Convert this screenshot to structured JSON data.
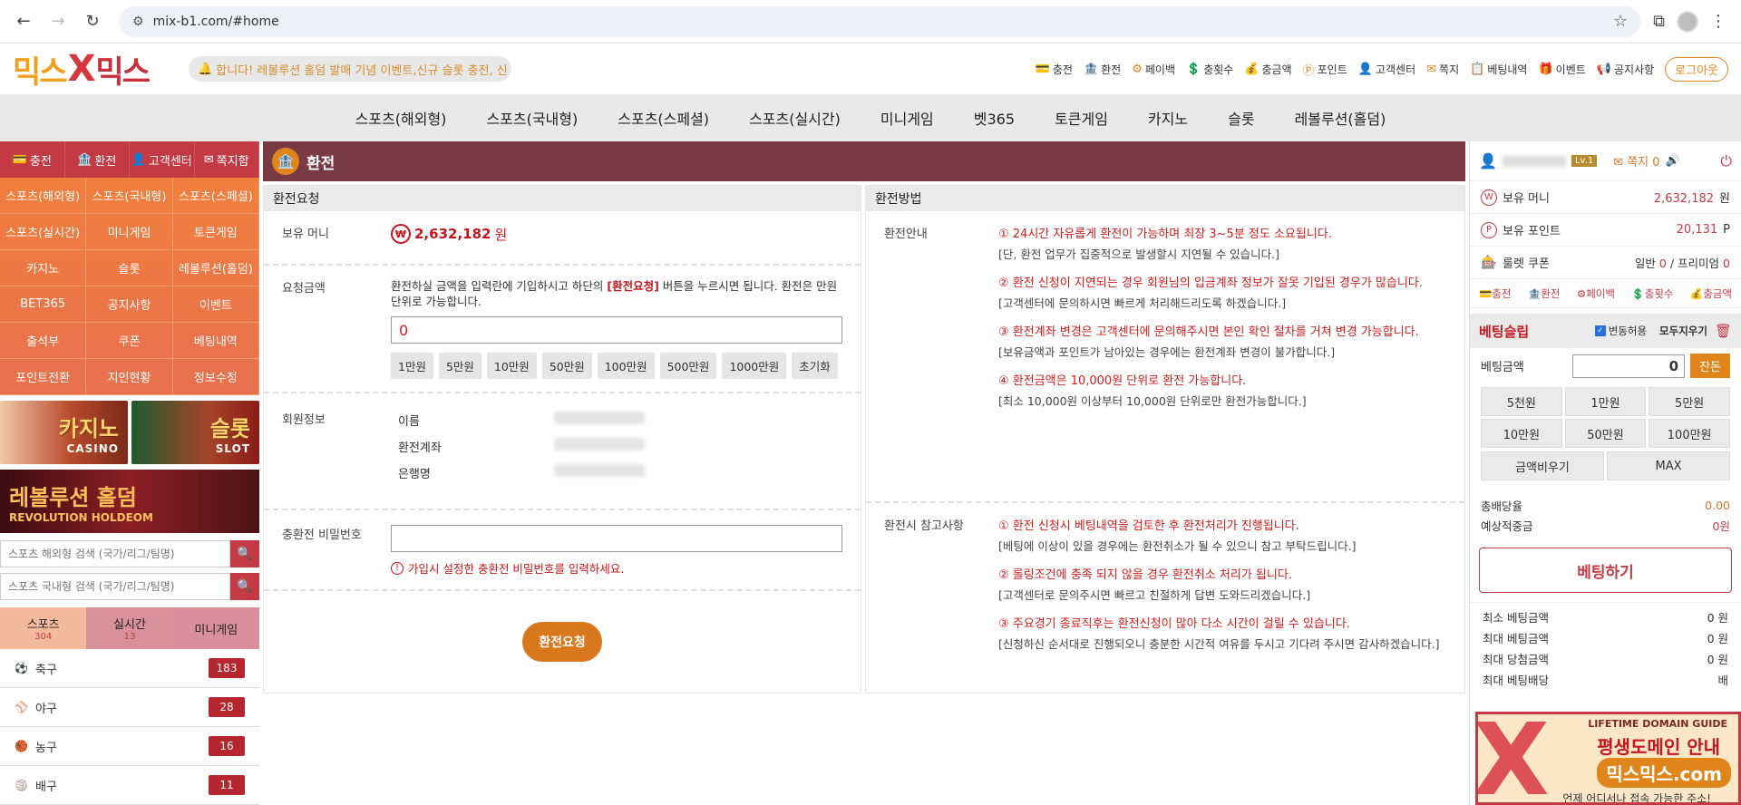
{
  "browser": {
    "url": "mix-b1.com/#home"
  },
  "header": {
    "logo": {
      "left": "믹스",
      "x": "X",
      "right": "믹스"
    },
    "ticker": "합니다! 레볼루션 홀덤 발매 기념 이벤트,신규 슬롯 충전, 신",
    "links": [
      {
        "icon": "💳",
        "label": "충전"
      },
      {
        "icon": "🏦",
        "label": "환전"
      },
      {
        "icon": "⚙",
        "label": "페이백"
      },
      {
        "icon": "💲",
        "label": "충횟수"
      },
      {
        "icon": "💰",
        "label": "충금액"
      },
      {
        "icon": "Ⓟ",
        "label": "포인트"
      },
      {
        "icon": "👤",
        "label": "고객센터"
      },
      {
        "icon": "✉",
        "label": "쪽지"
      },
      {
        "icon": "📋",
        "label": "베팅내역"
      },
      {
        "icon": "🎁",
        "label": "이벤트"
      },
      {
        "icon": "📢",
        "label": "공지사항"
      }
    ],
    "logout": "로그아웃"
  },
  "main_nav": [
    "스포츠(해외형)",
    "스포츠(국내형)",
    "스포츠(스페셜)",
    "스포츠(실시간)",
    "미니게임",
    "벳365",
    "토큰게임",
    "카지노",
    "슬롯",
    "레볼루션(홀덤)"
  ],
  "sidebar": {
    "quick_tabs": [
      "충전",
      "환전",
      "고객센터",
      "쪽지함"
    ],
    "grid": [
      "스포츠(해외형)",
      "스포츠(국내형)",
      "스포츠(스페셜)",
      "스포츠(실시간)",
      "미니게임",
      "토큰게임",
      "카지노",
      "슬롯",
      "레볼루션(홀덤)",
      "BET365",
      "공지사항",
      "이벤트",
      "출석부",
      "쿠폰",
      "베팅내역",
      "포인트전환",
      "지인현황",
      "정보수정"
    ],
    "banner_casino": {
      "big": "카지노",
      "small": "CASINO"
    },
    "banner_slot": {
      "big": "슬롯",
      "small": "SLOT"
    },
    "banner_holdem": {
      "big": "레볼루션 홀덤",
      "small": "REVOLUTION HOLDEOM"
    },
    "search1": "스포츠 해외형 검색 (국가/리그/팀명)",
    "search2": "스포츠 국내형 검색 (국가/리그/팀명)",
    "cat_tabs": [
      {
        "label": "스포츠",
        "count": "304"
      },
      {
        "label": "실시간",
        "count": "13"
      },
      {
        "label": "미니게임",
        "count": ""
      }
    ],
    "sports": [
      {
        "icon": "⚽",
        "label": "축구",
        "count": "183"
      },
      {
        "icon": "⚾",
        "label": "야구",
        "count": "28"
      },
      {
        "icon": "🏀",
        "label": "농구",
        "count": "16"
      },
      {
        "icon": "🏐",
        "label": "배구",
        "count": "11"
      }
    ]
  },
  "panel": {
    "title": "환전",
    "left_head": "환전요청",
    "right_head": "환전방법",
    "balance_label": "보유 머니",
    "balance_value": "2,632,182",
    "balance_unit": "원",
    "request_label": "요청금액",
    "request_desc_a": "환전하실 금액을 입력란에 기입하시고 하단의 ",
    "request_desc_hl": "[환전요청]",
    "request_desc_b": " 버튼을 누르시면 됩니다. 환전은 만원단위로 가능합니다.",
    "request_value": "0",
    "chips": [
      "1만원",
      "5만원",
      "10만원",
      "50만원",
      "100만원",
      "500만원",
      "1000만원",
      "초기화"
    ],
    "member_label": "회원정보",
    "member_keys": [
      "이름",
      "환전계좌",
      "은행명"
    ],
    "pw_label": "충환전 비밀번호",
    "pw_warn": "가입시 설정한 충환전 비밀번호를 입력하세요.",
    "submit": "환전요청",
    "guide_label": "환전안내",
    "guide": [
      {
        "r": "① 24시간 자유롭게 환전이 가능하며 최장 3~5분 정도 소요됩니다.",
        "s": "[단, 환전 업무가 집중적으로 발생할시 지연될 수 있습니다.]"
      },
      {
        "r": "② 환전 신청이 지연되는 경우 회원님의 입금계좌 정보가 잘못 기입된 경우가 많습니다.",
        "s": "[고객센터에 문의하시면 빠르게 처리해드리도록 하겠습니다.]"
      },
      {
        "r": "③ 환전계좌 변경은 고객센터에 문의해주시면 본인 확인 절차를 거쳐 변경 가능합니다.",
        "s": "[보유금액과 포인트가 남아있는 경우에는 환전계좌 변경이 불가합니다.]"
      },
      {
        "r": "④ 환전금액은 10,000원 단위로 환전 가능합니다.",
        "s": "[최소 10,000원 이상부터 10,000원 단위로만 환전가능합니다.]"
      }
    ],
    "ref_label": "환전시 참고사항",
    "ref": [
      {
        "r": "① 환전 신청시 베팅내역을 검토한 후 환전처리가 진행됩니다.",
        "s": "[베팅에 이상이 있을 경우에는 환전취소가 될 수 있으니 참고 부탁드립니다.]"
      },
      {
        "r": "② 롤링조건에 충족 되지 않을 경우 환전취소 처리가 됩니다.",
        "s": "[고객센터로 문의주시면 빠르고 친절하게 답변 도와드리겠습니다.]"
      },
      {
        "r": "③ 주요경기 종료직후는 환전신청이 많아 다소 시간이 걸릴 수 있습니다.",
        "s": "[신청하신 순서대로 진행되오니 충분한 시간적 여유를 두시고 기다려 주시면 감사하겠습니다.]"
      }
    ]
  },
  "right": {
    "level": "Lv.1",
    "note": "쪽지 0",
    "money_label": "보유 머니",
    "money_value": "2,632,182",
    "money_unit": "원",
    "point_label": "보유 포인트",
    "point_value": "20,131",
    "point_unit": "P",
    "coupon_label": "룰렛 쿠폰",
    "coupon_a": "일반",
    "coupon_a_val": "0",
    "coupon_sep": "/",
    "coupon_b": "프리미엄",
    "coupon_b_val": "0",
    "mini_links": [
      "충전",
      "환전",
      "페이백",
      "충횟수",
      "충금액"
    ],
    "slip_title": "베팅슬립",
    "odds_toggle": "변동허용",
    "clear_all": "모두지우기",
    "bet_label": "베팅금액",
    "bet_value": "0",
    "balance_btn": "잔돈",
    "amounts": [
      "5천원",
      "1만원",
      "5만원",
      "10만원",
      "50만원",
      "100만원"
    ],
    "clear_amount": "금액비우기",
    "max": "MAX",
    "total_odds_label": "총배당율",
    "total_odds_value": "0.00",
    "expected_label": "예상적중금",
    "expected_value": "0원",
    "bet_button": "베팅하기",
    "limits": [
      {
        "k": "최소 베팅금액",
        "v": "0 원"
      },
      {
        "k": "최대 베팅금액",
        "v": "0 원"
      },
      {
        "k": "최대 당첨금액",
        "v": "0 원"
      },
      {
        "k": "최대 베팅배당",
        "v": "배"
      }
    ],
    "domain_banner": {
      "t1": "LIFETIME DOMAIN GUIDE",
      "t2": "평생도메인 안내",
      "t3": "믹스믹스.com",
      "t4": "언제 어디서나 접속 가능한 주소!"
    }
  }
}
